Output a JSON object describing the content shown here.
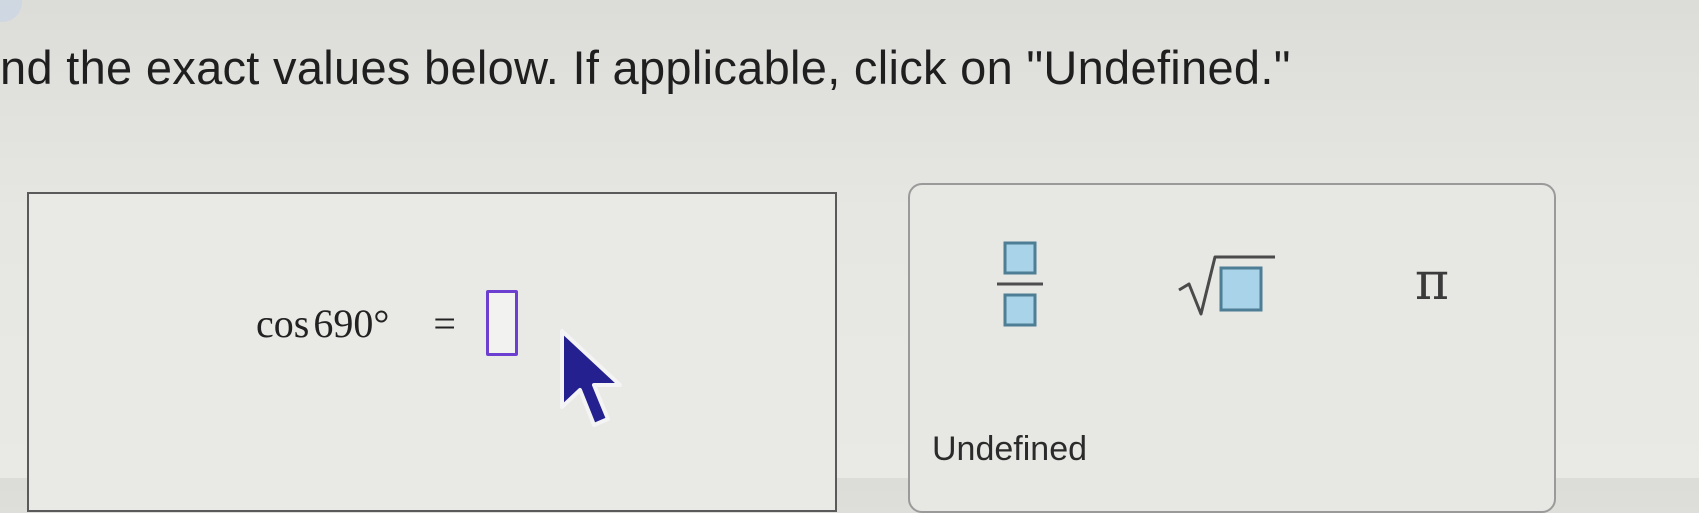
{
  "instruction": "nd the exact values below. If applicable, click on \"Undefined.\"",
  "question": {
    "function": "cos",
    "angle": "690°",
    "equals": "=",
    "answer_value": ""
  },
  "palette": {
    "fraction_icon": "fraction-template-icon",
    "sqrt_icon": "square-root-template-icon",
    "pi_symbol": "π",
    "undefined_label": "Undefined"
  },
  "colors": {
    "input_border": "#6d3fd1",
    "template_box_fill": "#a9d3e8",
    "template_box_stroke": "#4e7e95",
    "cursor_fill": "#24208f"
  }
}
